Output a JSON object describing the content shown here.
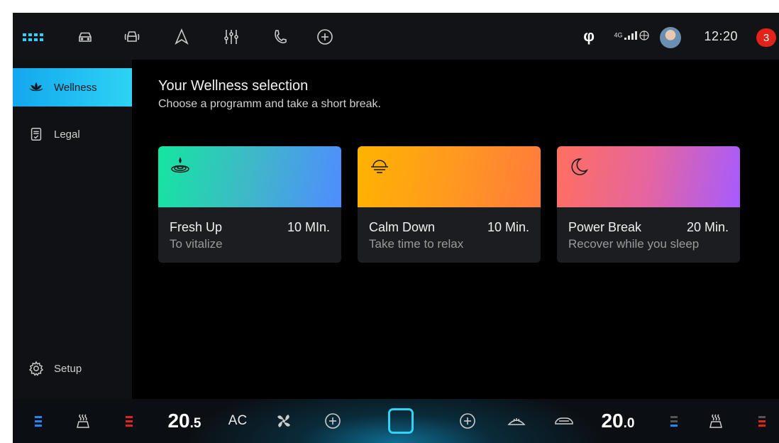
{
  "topbar": {
    "icons": [
      "apps-grid-icon",
      "car-icon",
      "car-front-icon",
      "navigation-icon",
      "equalizer-icon",
      "phone-icon",
      "add-circle-icon"
    ],
    "status": {
      "signal_label": "4G",
      "time": "12:20",
      "notification_count": "3"
    }
  },
  "sidebar": {
    "items": [
      {
        "label": "Wellness",
        "icon": "lotus-icon",
        "active": true
      },
      {
        "label": "Legal",
        "icon": "document-icon",
        "active": false
      }
    ],
    "setup_label": "Setup"
  },
  "main": {
    "title": "Your Wellness selection",
    "subtitle": "Choose a programm and take a short break.",
    "cards": [
      {
        "name": "Fresh Up",
        "duration": "10 MIn.",
        "description": "To vitalize",
        "icon": "water-drop-icon",
        "gradient": [
          "#14e6a0",
          "#4f8cff"
        ]
      },
      {
        "name": "Calm Down",
        "duration": "10 Min.",
        "description": "Take time to relax",
        "icon": "sunset-icon",
        "gradient": [
          "#ffb300",
          "#ff7a3d"
        ]
      },
      {
        "name": "Power Break",
        "duration": "20 Min.",
        "description": "Recover while you sleep",
        "icon": "moon-icon",
        "gradient": [
          "#ff6f5e",
          "#a65bff"
        ]
      }
    ]
  },
  "climate": {
    "left_temp_int": "20",
    "left_temp_dec": ".5",
    "ac_label": "AC",
    "right_temp_int": "20",
    "right_temp_dec": ".0"
  },
  "colors": {
    "accent": "#2ed3f5",
    "heat": "#e2231a",
    "cool": "#1e88ff"
  }
}
